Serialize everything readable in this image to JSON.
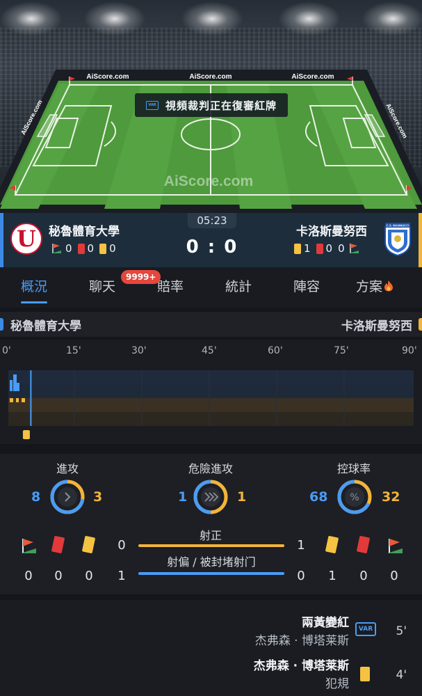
{
  "pitch": {
    "brand_small": "AiScore.com",
    "brand_large": "AiScore.com",
    "var_banner_text": "視頻裁判正在復審紅牌",
    "var_icon_text": "VAR"
  },
  "match": {
    "home_name": "秘魯體育大學",
    "away_name": "卡洛斯曼努西",
    "clock": "05:23",
    "score": "0 : 0",
    "home_stats": {
      "corners": "0",
      "red_cards": "0",
      "yellow_cards": "0"
    },
    "away_stats": {
      "yellow_cards": "1",
      "red_cards": "0",
      "corners": "0"
    },
    "away_logo_text": "C.S. MANNUCCI",
    "home_logo_text": "U"
  },
  "tabs": [
    {
      "label": "概況",
      "active": true
    },
    {
      "label": "聊天",
      "badge": "9999+"
    },
    {
      "label": "賠率"
    },
    {
      "label": "統計"
    },
    {
      "label": "陣容"
    },
    {
      "label": "方案",
      "icon": "fire-icon"
    }
  ],
  "team_header": {
    "home": "秘魯體育大學",
    "away": "卡洛斯曼努西"
  },
  "timeline": {
    "ticks": [
      "0'",
      "15'",
      "30'",
      "45'",
      "60'",
      "75'",
      "90'"
    ],
    "current_minute": 5,
    "card_minute": 4
  },
  "stats": {
    "attacks": {
      "label": "進攻",
      "home": "8",
      "away": "3"
    },
    "dangerous_attacks": {
      "label": "危險進攻",
      "home": "1",
      "away": "1"
    },
    "possession": {
      "label": "控球率",
      "home": "68",
      "away": "32",
      "home_share": 0.68
    },
    "shots_on_target": {
      "label": "射正",
      "home": "0",
      "away": "1"
    },
    "shots_off": {
      "label": "射偏 / 被封堵射门",
      "home": "1",
      "away": "0"
    },
    "home_counts": {
      "corners": "0",
      "red": "0",
      "yellow": "0"
    },
    "away_counts": {
      "yellow": "1",
      "red": "0",
      "corners": "0"
    }
  },
  "events": [
    {
      "title": "兩黃變紅",
      "player": "杰弗森 · 博塔莱斯",
      "icon": "var-icon",
      "icon_text": "VAR",
      "minute": "5'"
    },
    {
      "title": "杰弗森 · 博塔莱斯",
      "player": "犯規",
      "icon": "yellow-card-icon",
      "minute": "4'"
    }
  ],
  "colors": {
    "home": "#3d8ae6",
    "away": "#f3b43b",
    "accent": "#4a9cf5",
    "pitch": "#4e9a3c"
  }
}
